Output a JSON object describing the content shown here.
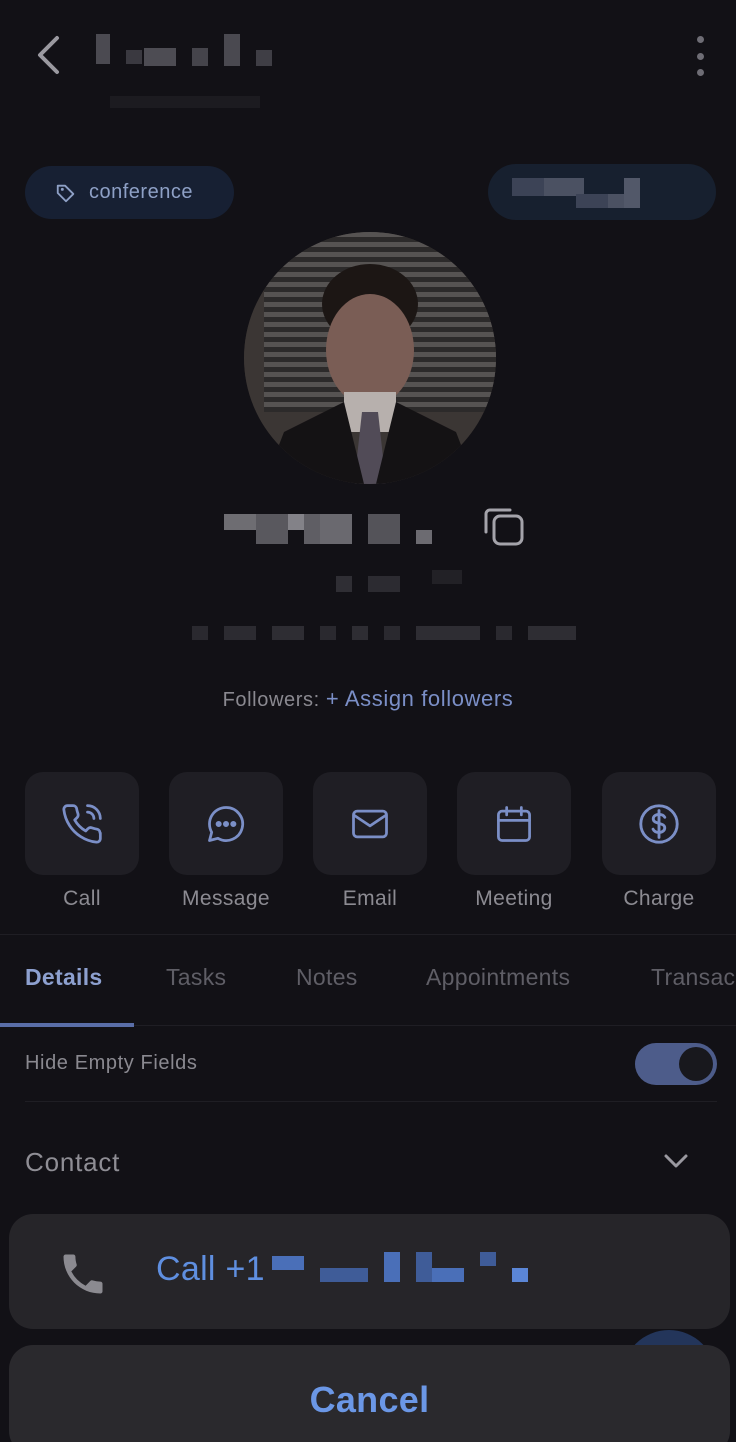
{
  "header": {
    "back_icon": "chevron-left-icon",
    "menu_icon": "more-vertical-icon"
  },
  "tag": {
    "label": "conference",
    "icon": "tag-icon"
  },
  "profile": {
    "copy_icon": "copy-icon",
    "followers_label": "Followers:",
    "assign_followers": "+ Assign followers"
  },
  "actions": [
    {
      "label": "Call",
      "icon": "phone-call-icon"
    },
    {
      "label": "Message",
      "icon": "message-bubble-icon"
    },
    {
      "label": "Email",
      "icon": "mail-icon"
    },
    {
      "label": "Meeting",
      "icon": "calendar-icon"
    },
    {
      "label": "Charge",
      "icon": "dollar-circle-icon"
    }
  ],
  "tabs": [
    {
      "label": "Details",
      "active": true
    },
    {
      "label": "Tasks",
      "active": false
    },
    {
      "label": "Notes",
      "active": false
    },
    {
      "label": "Appointments",
      "active": false
    },
    {
      "label": "Transac",
      "active": false
    }
  ],
  "settings": {
    "hide_empty_fields_label": "Hide Empty Fields",
    "hide_empty_fields_on": true
  },
  "sections": {
    "contact_label": "Contact"
  },
  "action_sheet": {
    "call_label": "Call +1",
    "phone_icon": "phone-icon",
    "cancel_label": "Cancel"
  },
  "colors": {
    "background": "#121116",
    "accent": "#6b97e6",
    "chip_bg": "#172033",
    "tile_bg": "#1f1e24"
  }
}
